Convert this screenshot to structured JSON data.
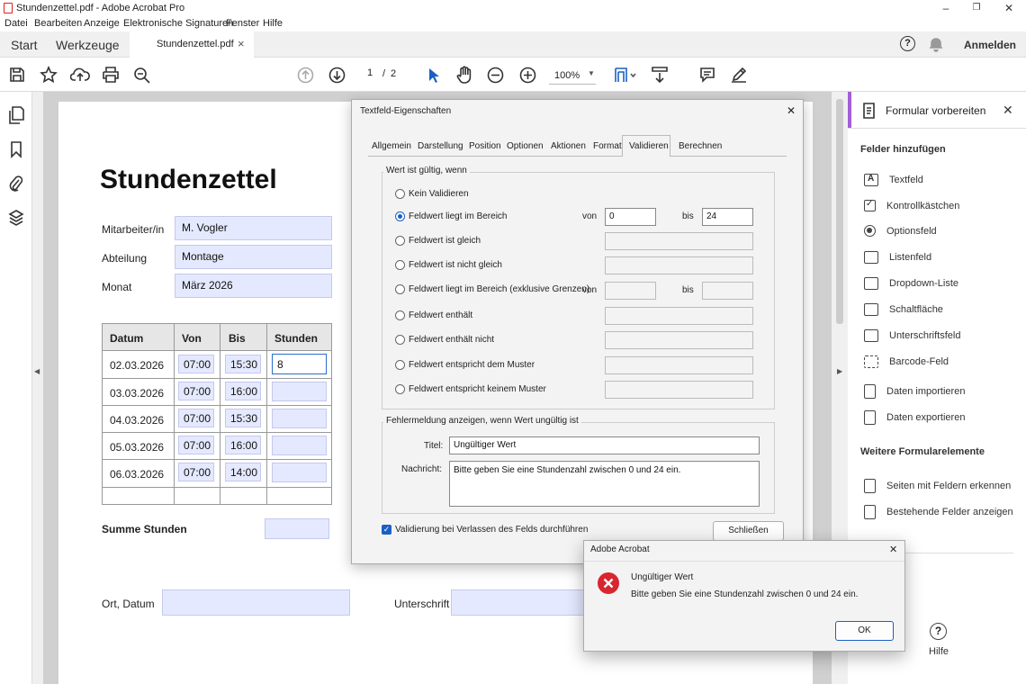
{
  "window": {
    "title": "Stundenzettel.pdf - Adobe Acrobat Pro",
    "minimize": "–",
    "maximize": "❐",
    "close": "✕"
  },
  "menu": [
    "Datei",
    "Bearbeiten",
    "Anzeige",
    "Elektronische Signaturen",
    "Fenster",
    "Hilfe"
  ],
  "tabs": {
    "start": "Start",
    "tools": "Werkzeuge",
    "doc": "Stundenzettel.pdf",
    "doc_close": "×",
    "signin": "Anmelden",
    "help": "?"
  },
  "toolbar": {
    "page_current": "1",
    "page_sep": "/",
    "page_total": "2",
    "zoom": "100%"
  },
  "document": {
    "title": "Stundenzettel",
    "employee_label": "Mitarbeiter/in",
    "employee": "M. Vogler",
    "department_label": "Abteilung",
    "department": "Montage",
    "month_label": "Monat",
    "month": "März 2026",
    "table": {
      "headers": [
        "Datum",
        "Von",
        "Bis",
        "Stunden"
      ],
      "rows": [
        [
          "02.03.2026",
          "07:00",
          "15:30",
          "8"
        ],
        [
          "03.03.2026",
          "07:00",
          "16:00",
          ""
        ],
        [
          "04.03.2026",
          "07:00",
          "15:30",
          ""
        ],
        [
          "05.03.2026",
          "07:00",
          "16:00",
          ""
        ],
        [
          "06.03.2026",
          "07:00",
          "14:00",
          ""
        ]
      ]
    },
    "sum_label": "Summe Stunden",
    "place_date_label": "Ort, Datum",
    "signature_label": "Unterschrift"
  },
  "right_panel": {
    "title": "Formular vorbereiten",
    "close": "✕",
    "section1": "Felder hinzufügen",
    "items1": [
      "Textfeld",
      "Kontrollkästchen",
      "Optionsfeld",
      "Listenfeld",
      "Dropdown-Liste",
      "Schaltfläche",
      "Unterschriftsfeld",
      "Barcode-Feld",
      "Daten importieren",
      "Daten exportieren"
    ],
    "section2": "Weitere Formularelemente",
    "items2": [
      "Seiten mit Feldern erkennen",
      "Bestehende Felder anzeigen"
    ],
    "help": "Hilfe"
  },
  "dialog": {
    "title": "Textfeld-Eigenschaften",
    "close": "✕",
    "tabs": [
      "Allgemein",
      "Darstellung",
      "Position",
      "Optionen",
      "Aktionen",
      "Format",
      "Validieren",
      "Berechnen"
    ],
    "active_tab": "Validieren",
    "group1": "Wert ist gültig, wenn",
    "options": [
      "Kein Validieren",
      "Feldwert liegt im Bereich",
      "Feldwert ist gleich",
      "Feldwert ist nicht gleich",
      "Feldwert liegt im Bereich (exklusive Grenzen)",
      "Feldwert enthält",
      "Feldwert enthält nicht",
      "Feldwert entspricht dem Muster",
      "Feldwert entspricht keinem Muster"
    ],
    "selected_option": "Feldwert liegt im Bereich",
    "from_label": "von",
    "to_label": "bis",
    "from_value": "0",
    "to_value": "24",
    "group2": "Fehlermeldung anzeigen, wenn Wert ungültig ist",
    "title_label": "Titel:",
    "title_value": "Ungültiger Wert",
    "message_label": "Nachricht:",
    "message_value": "Bitte geben Sie eine Stundenzahl zwischen 0 und 24 ein.",
    "checkbox_label": "Validierung bei Verlassen des Felds durchführen",
    "checkbox_checked": true,
    "close_button": "Schließen"
  },
  "alert": {
    "title": "Adobe Acrobat",
    "close": "✕",
    "heading": "Ungültiger Wert",
    "message": "Bitte geben Sie eine Stundenzahl zwischen 0 und 24 ein.",
    "ok": "OK"
  }
}
